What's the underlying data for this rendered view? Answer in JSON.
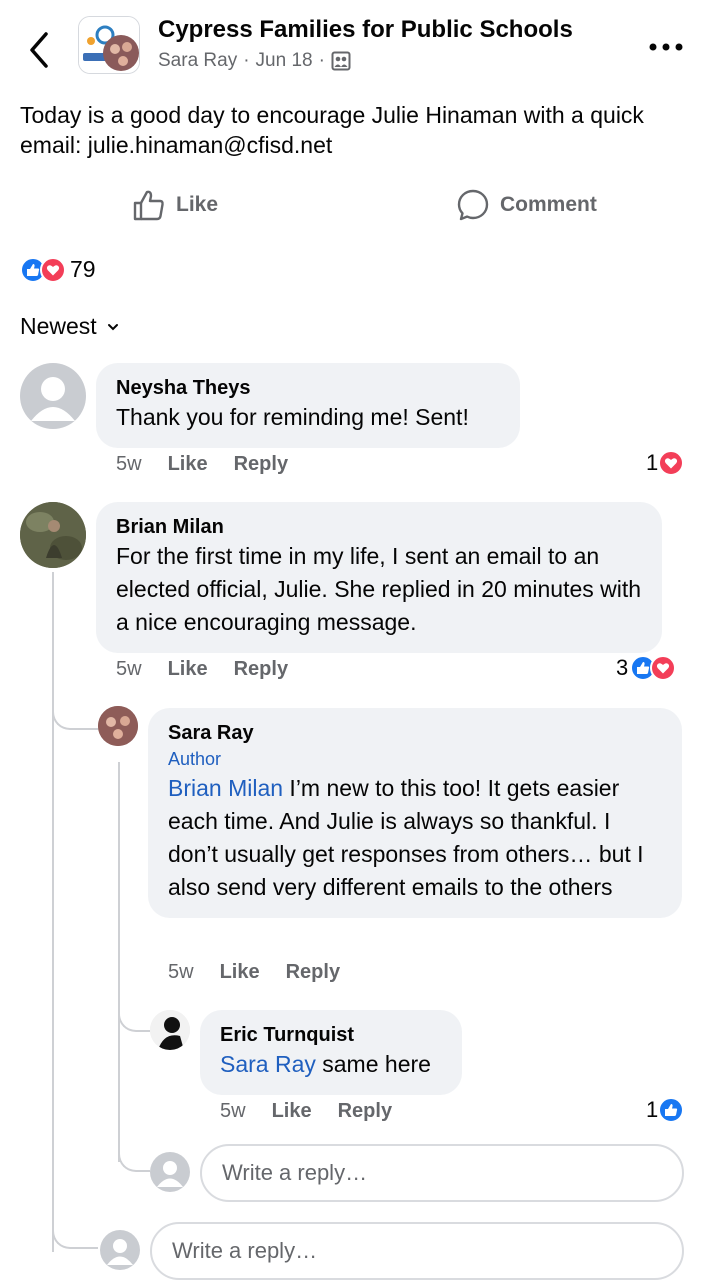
{
  "header": {
    "group_name": "Cypress Families for Public Schools",
    "author": "Sara Ray",
    "date": "Jun 18",
    "sep": "·"
  },
  "post": {
    "text": "Today is a good day to encourage Julie Hinaman with a quick email: julie.hinaman@cfisd.net",
    "like_label": "Like",
    "comment_label": "Comment",
    "reaction_count": "79"
  },
  "sort_label": "Newest",
  "comments": [
    {
      "name": "Neysha Theys",
      "text": "Thank you for reminding me! Sent!",
      "time": "5w",
      "like": "Like",
      "reply": "Reply",
      "reactions": "1"
    },
    {
      "name": "Brian Milan",
      "text": "For the first time in my life, I sent an email to an elected official, Julie. She replied in 20 minutes with a nice encouraging message.",
      "time": "5w",
      "like": "Like",
      "reply": "Reply",
      "reactions": "3"
    },
    {
      "name": "Sara Ray",
      "badge": "Author",
      "mention": "Brian Milan",
      "text": " I’m new to this too! It gets easier each time. And Julie is always so thankful. I don’t usually get responses from others… but I also send very different emails to the others",
      "time": "5w",
      "like": "Like",
      "reply": "Reply"
    },
    {
      "name": "Eric Turnquist",
      "mention": "Sara Ray",
      "text": " same here",
      "time": "5w",
      "like": "Like",
      "reply": "Reply",
      "reactions": "1"
    }
  ],
  "reply_placeholder": "Write a reply…",
  "colors": {
    "accent_blue": "#1877f2",
    "love_red": "#f33e58",
    "bubble": "#f0f2f5",
    "muted": "#65676b"
  }
}
